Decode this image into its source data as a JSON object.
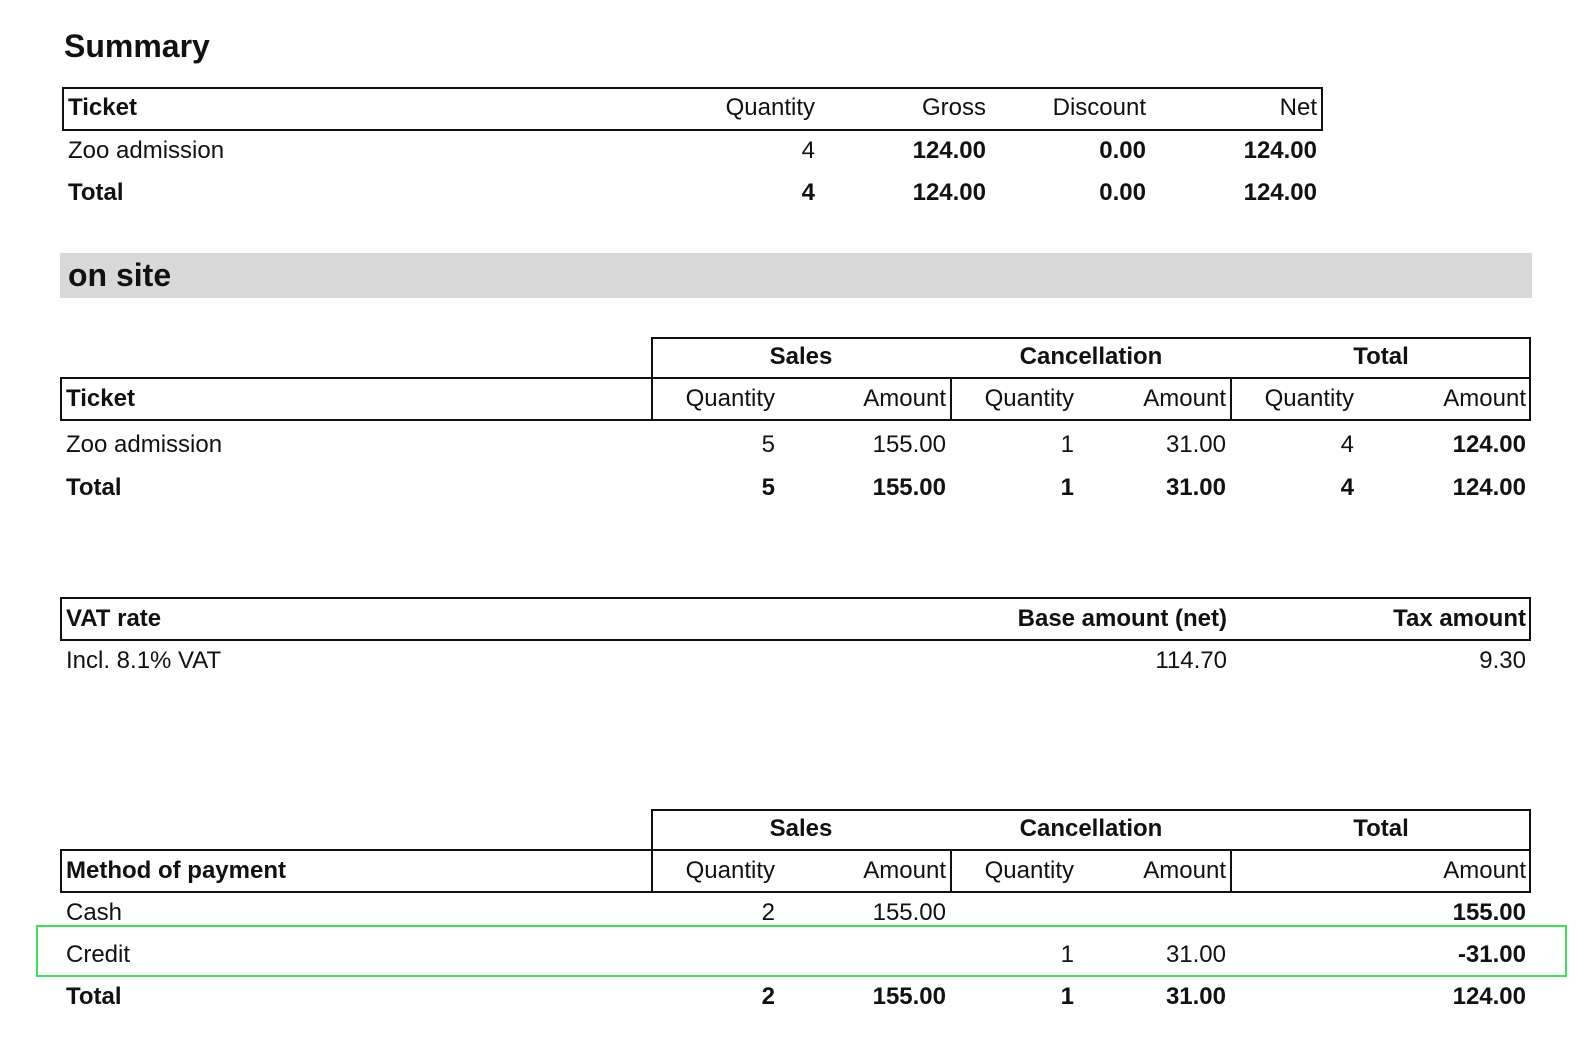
{
  "summary": {
    "title": "Summary",
    "headers": {
      "ticket": "Ticket",
      "quantity": "Quantity",
      "gross": "Gross",
      "discount": "Discount",
      "net": "Net"
    },
    "rows": [
      {
        "ticket": "Zoo admission",
        "quantity": "4",
        "gross": "124.00",
        "discount": "0.00",
        "net": "124.00"
      }
    ],
    "total": {
      "label": "Total",
      "quantity": "4",
      "gross": "124.00",
      "discount": "0.00",
      "net": "124.00"
    }
  },
  "section": {
    "title": "on site"
  },
  "tickets": {
    "groups": {
      "sales": "Sales",
      "cancellation": "Cancellation",
      "total": "Total"
    },
    "headers": {
      "ticket": "Ticket",
      "quantity": "Quantity",
      "amount": "Amount"
    },
    "rows": [
      {
        "ticket": "Zoo admission",
        "sales_qty": "5",
        "sales_amt": "155.00",
        "cancel_qty": "1",
        "cancel_amt": "31.00",
        "total_qty": "4",
        "total_amt": "124.00"
      }
    ],
    "total": {
      "label": "Total",
      "sales_qty": "5",
      "sales_amt": "155.00",
      "cancel_qty": "1",
      "cancel_amt": "31.00",
      "total_qty": "4",
      "total_amt": "124.00"
    }
  },
  "vat": {
    "headers": {
      "rate": "VAT rate",
      "base": "Base amount (net)",
      "tax": "Tax amount"
    },
    "rows": [
      {
        "rate": "Incl. 8.1% VAT",
        "base": "114.70",
        "tax": "9.30"
      }
    ]
  },
  "payment": {
    "groups": {
      "sales": "Sales",
      "cancellation": "Cancellation",
      "total": "Total"
    },
    "headers": {
      "method": "Method of payment",
      "quantity": "Quantity",
      "amount": "Amount"
    },
    "rows": [
      {
        "method": "Cash",
        "sales_qty": "2",
        "sales_amt": "155.00",
        "cancel_qty": "",
        "cancel_amt": "",
        "total_amt": "155.00"
      },
      {
        "method": "Credit",
        "sales_qty": "",
        "sales_amt": "",
        "cancel_qty": "1",
        "cancel_amt": "31.00",
        "total_amt": "-31.00"
      }
    ],
    "total": {
      "label": "Total",
      "sales_qty": "2",
      "sales_amt": "155.00",
      "cancel_qty": "1",
      "cancel_amt": "31.00",
      "total_amt": "124.00"
    }
  }
}
